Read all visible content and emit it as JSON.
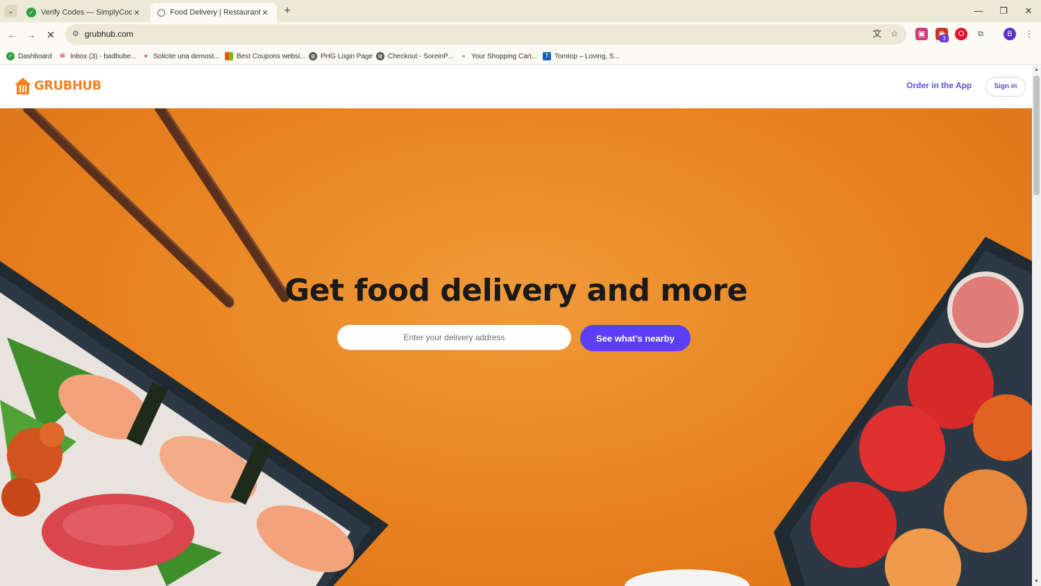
{
  "browser": {
    "tabs": [
      {
        "title": "Verify Codes — SimplyCodes",
        "favicon": "simplycodes-icon",
        "active": false
      },
      {
        "title": "Food Delivery | Restaurant Take",
        "favicon": "grubhub-icon",
        "active": true
      }
    ],
    "close_glyph": "✕",
    "new_tab_glyph": "+",
    "url": "grubhub.com",
    "profile_initial": "B",
    "extension_badge": "3",
    "bookmarks": [
      {
        "label": "Dashboard",
        "icon": "simplycodes-icon",
        "color": "#2e9e3e"
      },
      {
        "label": "Inbox (3) - badbube...",
        "icon": "gmail-icon",
        "color": "#d93025"
      },
      {
        "label": "Solicite una demost...",
        "icon": "pin-icon",
        "color": "#d93025"
      },
      {
        "label": "Best Coupons websi...",
        "icon": "grid-icon",
        "color": "#f25022"
      },
      {
        "label": "PHG Login Page",
        "icon": "globe-icon",
        "color": "#555555"
      },
      {
        "label": "Checkout - SoreinP...",
        "icon": "globe-icon",
        "color": "#555555"
      },
      {
        "label": "Your Shopping Cart...",
        "icon": "store-icon",
        "color": "#1c3f94"
      },
      {
        "label": "Tomtop – Loving, S...",
        "icon": "tomtop-icon",
        "color": "#1a5fb4"
      }
    ]
  },
  "site": {
    "logo_text": "GRUBHUB",
    "order_in_app": "Order in the App",
    "sign_in": "Sign in",
    "hero_title": "Get food delivery and more",
    "address_placeholder": "Enter your delivery address",
    "cta": "See what's nearby"
  },
  "colors": {
    "brand_orange": "#f58220",
    "hero_orange": "#e8821f",
    "accent_purple": "#5b3ef5",
    "link_purple": "#5a4fcf"
  }
}
